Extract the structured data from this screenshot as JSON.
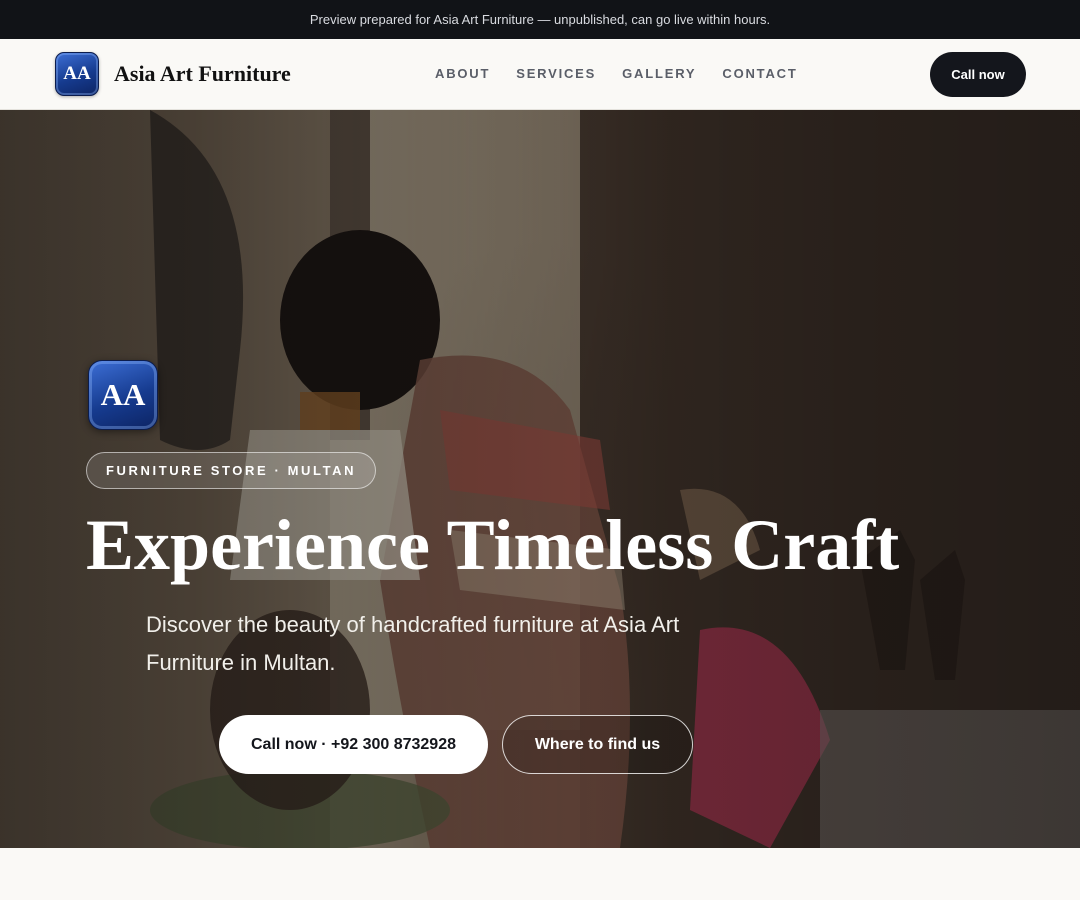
{
  "banner": {
    "text": "Preview prepared for Asia Art Furniture — unpublished, can go live within hours."
  },
  "header": {
    "logo_initials": "AA",
    "brand_name": "Asia Art Furniture",
    "nav": [
      {
        "label": "ABOUT"
      },
      {
        "label": "SERVICES"
      },
      {
        "label": "GALLERY"
      },
      {
        "label": "CONTACT"
      }
    ],
    "call_label": "Call now"
  },
  "hero": {
    "badge_initials": "AA",
    "eyebrow": "FURNITURE STORE · MULTAN",
    "title": "Experience Timeless Craft",
    "subtitle": "Discover the beauty of handcrafted furniture at Asia Art Furniture in Multan.",
    "cta_primary": "Call now · +92 300 8732928",
    "cta_secondary": "Where to find us",
    "background_image": "woman-in-furniture-showroom-photo"
  },
  "colors": {
    "dark": "#14161c",
    "badge_blue": "#163b8f",
    "page_bg": "#faf9f6"
  }
}
